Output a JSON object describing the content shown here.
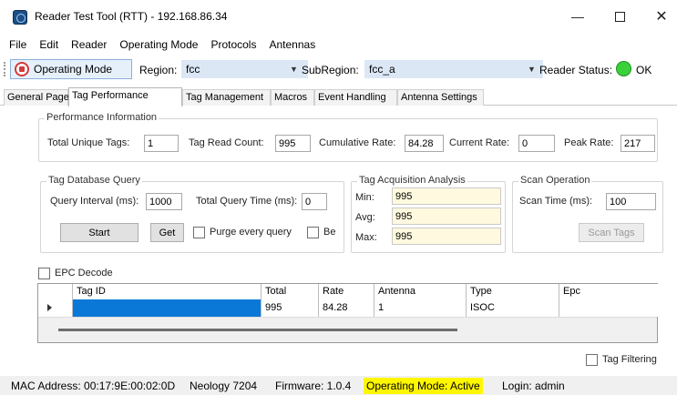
{
  "window": {
    "title": "Reader Test Tool (RTT) - 192.168.86.34",
    "minimize_glyph": "—",
    "close_glyph": "✕"
  },
  "menu": [
    "File",
    "Edit",
    "Reader",
    "Operating Mode",
    "Protocols",
    "Antennas"
  ],
  "toolbar": {
    "operating_mode_label": "Operating Mode",
    "region_label": "Region:",
    "region_value": "fcc",
    "subregion_label": "SubRegion:",
    "subregion_value": "fcc_a",
    "reader_status_label": "Reader Status:",
    "reader_status_value": "OK",
    "reader_status_color": "#3ad13a",
    "dropdown_glyph": "▼"
  },
  "tabs": [
    "General Page",
    "Tag Performance",
    "Tag Management",
    "Macros",
    "Event Handling",
    "Antenna Settings"
  ],
  "active_tab": "Tag Performance",
  "performance": {
    "group_title": "Performance Information",
    "total_unique_tags_label": "Total Unique Tags:",
    "total_unique_tags": "1",
    "tag_read_count_label": "Tag Read Count:",
    "tag_read_count": "995",
    "cumulative_rate_label": "Cumulative Rate:",
    "cumulative_rate": "84.28",
    "current_rate_label": "Current Rate:",
    "current_rate": "0",
    "peak_rate_label": "Peak Rate:",
    "peak_rate": "217"
  },
  "db_query": {
    "group_title": "Tag Database Query",
    "query_interval_label": "Query Interval (ms):",
    "query_interval": "1000",
    "total_query_time_label": "Total Query Time (ms):",
    "total_query_time": "0",
    "start_label": "Start",
    "get_label": "Get",
    "purge_label": "Purge every query",
    "be_label": "Be"
  },
  "acquisition": {
    "group_title": "Tag Acquisition Analysis",
    "min_label": "Min:",
    "min": "995",
    "avg_label": "Avg:",
    "avg": "995",
    "max_label": "Max:",
    "max": "995"
  },
  "scan": {
    "group_title": "Scan Operation",
    "scan_time_label": "Scan Time (ms):",
    "scan_time": "100",
    "scan_tags_label": "Scan Tags"
  },
  "epc_decode_label": "EPC Decode",
  "table": {
    "columns": [
      "Tag ID",
      "Total",
      "Rate",
      "Antenna",
      "Type",
      "Epc"
    ],
    "rows": [
      [
        "",
        "995",
        "84.28",
        "1",
        "ISOC",
        ""
      ]
    ]
  },
  "tag_filtering_label": "Tag Filtering",
  "status": {
    "mac": "MAC Address: 00:17:9E:00:02:0D",
    "model": "Neology 7204",
    "firmware": "Firmware: 1.0.4",
    "operating_mode": "Operating Mode: Active",
    "login": "Login: admin",
    "highlight_color": "#fff700"
  }
}
